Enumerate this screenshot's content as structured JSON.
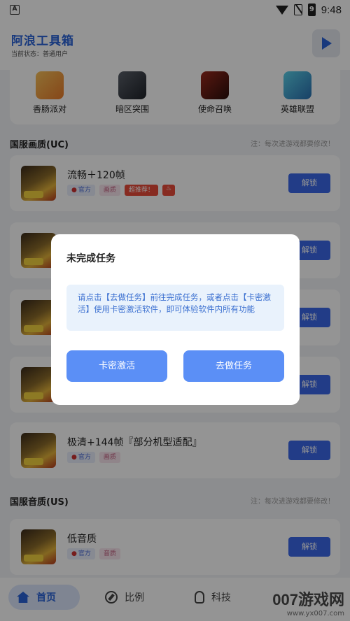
{
  "status_bar": {
    "time": "9:48",
    "battery": "9"
  },
  "header": {
    "title": "阿浪工具箱",
    "status": "当前状态：普通用户"
  },
  "games": [
    {
      "label": "香肠派对",
      "color": "#f0a83a"
    },
    {
      "label": "暗区突围",
      "color": "#3a3f47"
    },
    {
      "label": "使命召唤",
      "color": "#6b1a15"
    },
    {
      "label": "英雄联盟",
      "color": "#2f9fd6"
    }
  ],
  "sections": [
    {
      "title": "国服画质(UC)",
      "note": "注：每次进游戏都要修改！"
    },
    {
      "title": "国服音质(US)",
      "note": "注：每次进游戏都要修改！"
    }
  ],
  "cards": [
    {
      "title": "流畅＋120帧",
      "tags": [
        "官方",
        "画质"
      ],
      "hot": "超推荐！"
    },
    {
      "title": ""
    },
    {
      "title": ""
    },
    {
      "title": ""
    },
    {
      "title": "极清+144帧『部分机型适配』",
      "tags": [
        "官方",
        "画质"
      ]
    },
    {
      "title": "低音质",
      "tags": [
        "官方",
        "音质"
      ]
    }
  ],
  "unlock_label": "解锁",
  "dialog": {
    "title": "未完成任务",
    "message": "请点击【去做任务】前往完成任务，或者点击【卡密激活】使用卡密激活软件，即可体验软件内所有功能",
    "left_button": "卡密激活",
    "right_button": "去做任务"
  },
  "nav": [
    {
      "label": "首页",
      "active": true,
      "icon": "home-icon"
    },
    {
      "label": "比例",
      "icon": "compass-icon"
    },
    {
      "label": "科技",
      "icon": "bulb-icon"
    }
  ],
  "watermark": {
    "big": "007游戏网",
    "small": "www.yx007.com"
  },
  "colors": {
    "accent": "#2a63d8",
    "unlock": "#3b68e8",
    "dialog_button": "#5b8ff6"
  }
}
